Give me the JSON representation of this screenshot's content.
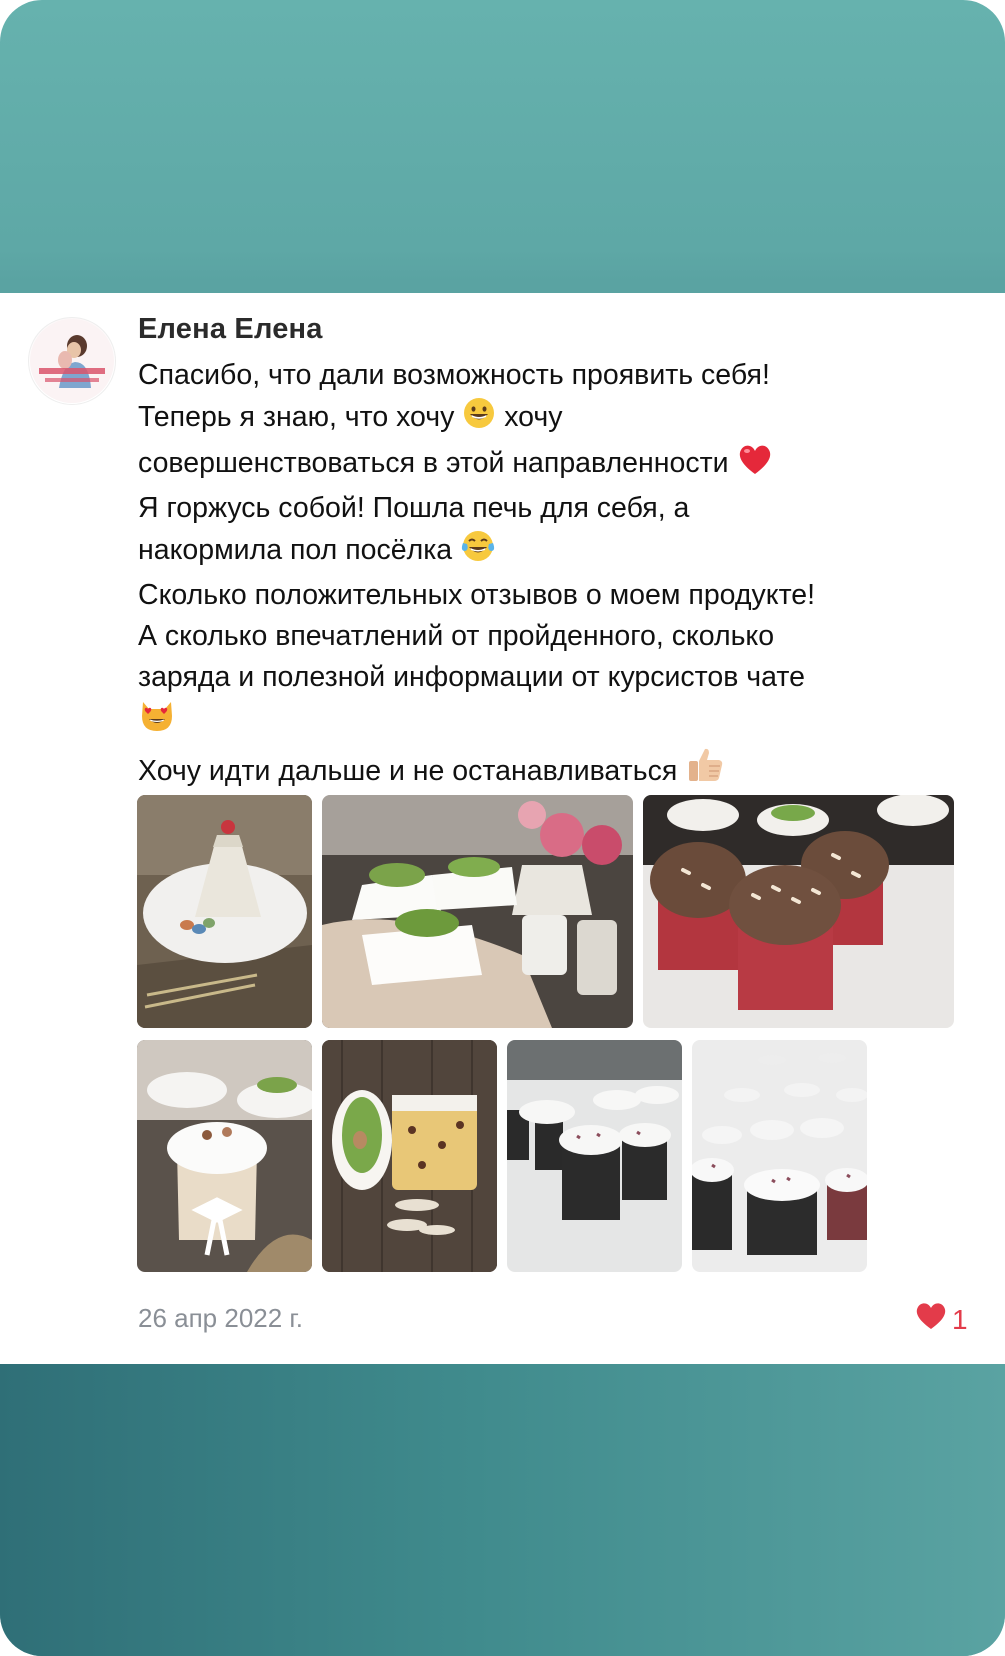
{
  "post": {
    "author": "Елена Елена",
    "lines": [
      "Спасибо, что дали возможность проявить себя!",
      "Теперь я знаю, что хочу",
      "хочу",
      "совершенствоваться в этой направленности",
      "Я горжусь собой! Пошла печь для себя, а",
      "накормила пол посёлка",
      "Сколько положительных отзывов о моем продукте!",
      "А сколько впечатлений  от пройденного, сколько",
      "заряда и полезной информации от курсистов чате",
      "Хочу идти дальше и не останавливаться"
    ],
    "date": "26 апр 2022 г.",
    "likes": "1"
  },
  "icons": [
    "grinning-face-icon",
    "red-heart-icon",
    "tears-of-joy-face-icon",
    "heart-eyes-cat-icon",
    "thumbs-up-icon",
    "like-heart-icon"
  ],
  "colors": {
    "accent_teal": "#5ea8a6",
    "like_red": "#e33b4a",
    "date_grey": "#8a8f96"
  }
}
